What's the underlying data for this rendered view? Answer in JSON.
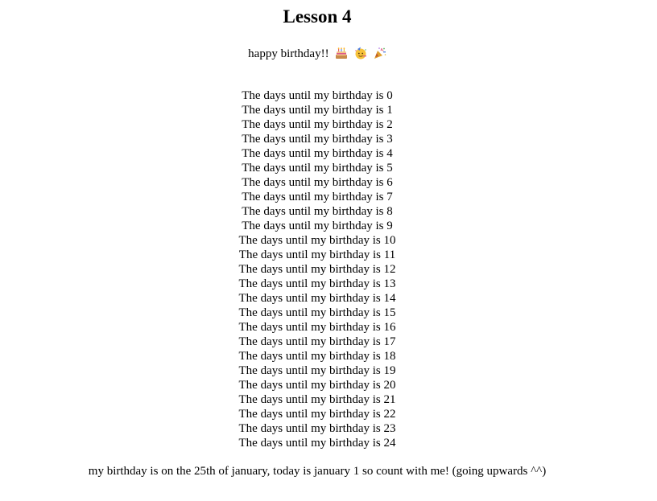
{
  "page": {
    "title": "Lesson 4",
    "greeting": "happy birthday!!",
    "emojis": [
      "birthday-cake-icon",
      "partying-face-icon",
      "party-popper-icon"
    ],
    "countdown_prefix": "The days until my birthday is",
    "countdown": [
      "The days until my birthday is 0",
      "The days until my birthday is 1",
      "The days until my birthday is 2",
      "The days until my birthday is 3",
      "The days until my birthday is 4",
      "The days until my birthday is 5",
      "The days until my birthday is 6",
      "The days until my birthday is 7",
      "The days until my birthday is 8",
      "The days until my birthday is 9",
      "The days until my birthday is 10",
      "The days until my birthday is 11",
      "The days until my birthday is 12",
      "The days until my birthday is 13",
      "The days until my birthday is 14",
      "The days until my birthday is 15",
      "The days until my birthday is 16",
      "The days until my birthday is 17",
      "The days until my birthday is 18",
      "The days until my birthday is 19",
      "The days until my birthday is 20",
      "The days until my birthday is 21",
      "The days until my birthday is 22",
      "The days until my birthday is 23",
      "The days until my birthday is 24"
    ],
    "footer": "my birthday is on the 25th of january, today is january 1 so count with me! (going upwards ^^)"
  }
}
